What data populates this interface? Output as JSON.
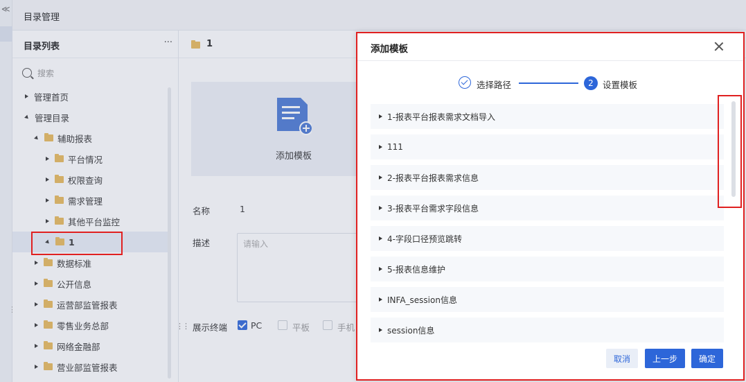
{
  "breadcrumb": "目录管理",
  "dir_panel": {
    "title": "目录列表",
    "more": "···",
    "search_placeholder": "搜索"
  },
  "tree": {
    "items": [
      {
        "label": "管理首页"
      },
      {
        "label": "管理目录"
      },
      {
        "label": "辅助报表"
      },
      {
        "label": "平台情况"
      },
      {
        "label": "权限查询"
      },
      {
        "label": "需求管理"
      },
      {
        "label": "其他平台监控"
      },
      {
        "label": "1"
      },
      {
        "label": "数据标准"
      },
      {
        "label": "公开信息"
      },
      {
        "label": "运营部监管报表"
      },
      {
        "label": "零售业务总部"
      },
      {
        "label": "网络金融部"
      },
      {
        "label": "营业部监管报表"
      }
    ]
  },
  "content": {
    "folder_name": "1",
    "card_label": "添加模板",
    "name_label": "名称",
    "name_value": "1",
    "desc_label": "描述",
    "desc_placeholder": "请输入",
    "terminal_label": "展示终端",
    "terminals": [
      {
        "label": "PC",
        "checked": true
      },
      {
        "label": "平板",
        "checked": false
      },
      {
        "label": "手机",
        "checked": false
      }
    ]
  },
  "dialog": {
    "title": "添加模板",
    "steps": [
      {
        "number": "1",
        "label": "选择路径",
        "done": true
      },
      {
        "number": "2",
        "label": "设置模板",
        "done": false
      }
    ],
    "templates": [
      {
        "label": "1-报表平台报表需求文档导入"
      },
      {
        "label": "111"
      },
      {
        "label": "2-报表平台报表需求信息"
      },
      {
        "label": "3-报表平台需求字段信息"
      },
      {
        "label": "4-字段口径预览跳转"
      },
      {
        "label": "5-报表信息维护"
      },
      {
        "label": "INFA_session信息"
      },
      {
        "label": "session信息"
      }
    ],
    "buttons": {
      "cancel": "取消",
      "prev": "上一步",
      "ok": "确定"
    }
  },
  "colors": {
    "primary": "#2d66d9",
    "folder": "#e9b959",
    "highlight_box": "#e02020"
  }
}
